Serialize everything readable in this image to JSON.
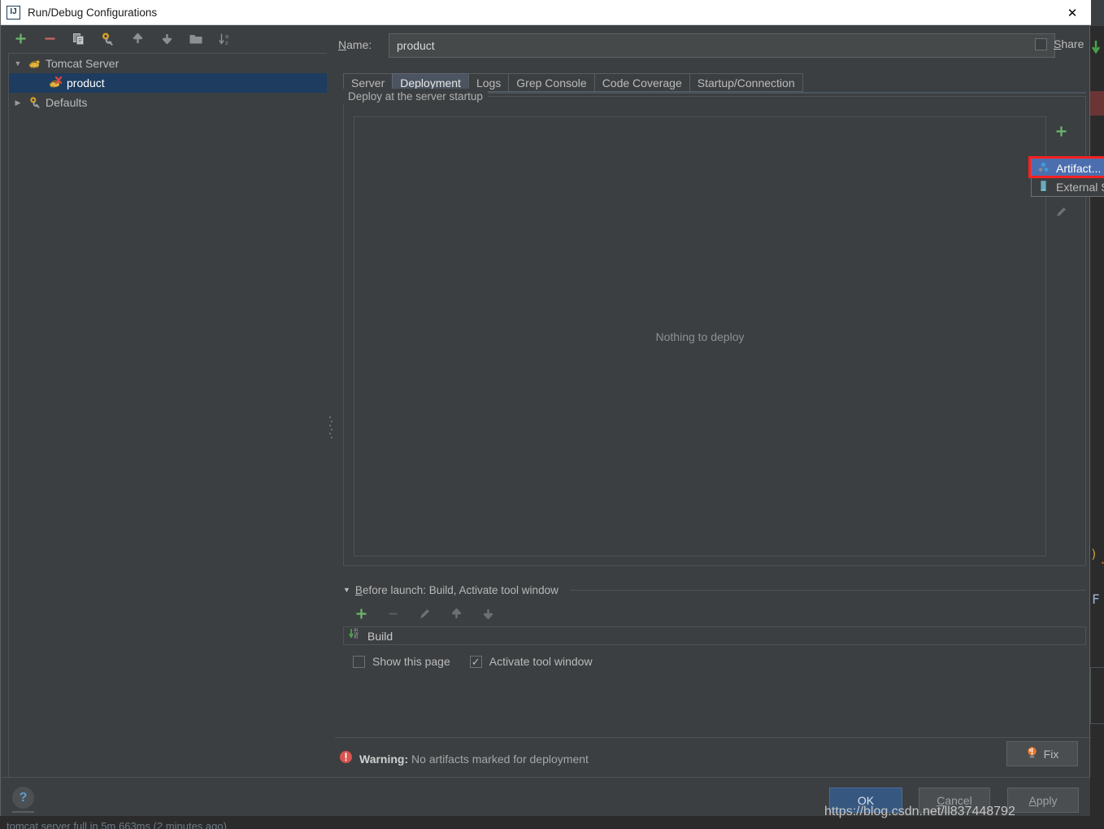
{
  "window": {
    "title": "Run/Debug Configurations",
    "logo_text": "IJ",
    "close_icon": "close-icon"
  },
  "left_toolbar": {
    "buttons": [
      {
        "name": "add-configuration-button",
        "icon": "plus-icon",
        "color": "#6cb76c"
      },
      {
        "name": "remove-configuration-button",
        "icon": "minus-icon",
        "color": "#cc6666"
      },
      {
        "name": "copy-configuration-button",
        "icon": "copy-icon",
        "color": "#9aa0a6"
      },
      {
        "name": "edit-templates-button",
        "icon": "gear-wrench-icon",
        "color": "#d9a31f"
      },
      {
        "name": "move-up-button",
        "icon": "arrow-up-icon",
        "color": "#8b9094"
      },
      {
        "name": "move-down-button",
        "icon": "arrow-down-icon",
        "color": "#8b9094"
      },
      {
        "name": "create-folder-button",
        "icon": "folder-icon",
        "color": "#8b9094"
      },
      {
        "name": "sort-configurations-button",
        "icon": "sort-az-icon",
        "color": "#8b9094"
      }
    ]
  },
  "tree": {
    "items": [
      {
        "label": "Tomcat Server",
        "icon": "tomcat-icon",
        "expanded": true,
        "arrow": "▼",
        "level": 0,
        "selected": false
      },
      {
        "label": "product",
        "icon": "tomcat-error-icon",
        "expanded": false,
        "arrow": "",
        "level": 1,
        "selected": true
      },
      {
        "label": "Defaults",
        "icon": "gear-wrench-icon",
        "expanded": false,
        "arrow": "▶",
        "level": 0,
        "selected": false
      }
    ]
  },
  "name_row": {
    "label": "Name:",
    "label_mnemonic": "N",
    "label_rest": "ame:",
    "value": "product",
    "placeholder": "Name",
    "share_label": "Share",
    "share_mnemonic": "S",
    "share_rest": "hare",
    "share_checked": false
  },
  "tabs": [
    {
      "label": "Server",
      "active": false
    },
    {
      "label": "Deployment",
      "active": true
    },
    {
      "label": "Logs",
      "active": false
    },
    {
      "label": "Grep Console",
      "active": false
    },
    {
      "label": "Code Coverage",
      "active": false
    },
    {
      "label": "Startup/Connection",
      "active": false
    }
  ],
  "deployment": {
    "group_title": "Deploy at the server startup",
    "empty_text": "Nothing to deploy",
    "side_buttons": [
      {
        "name": "add-deployment-button",
        "icon": "plus-icon",
        "enabled": true
      },
      {
        "name": "remove-deployment-button",
        "icon": "minus-icon",
        "enabled": false
      },
      {
        "name": "move-deployment-down-button",
        "icon": "arrow-down-icon",
        "enabled": false
      },
      {
        "name": "edit-deployment-button",
        "icon": "pencil-icon",
        "enabled": false
      }
    ],
    "add_popup": {
      "items": [
        {
          "label": "Artifact...",
          "icon": "artifact-icon",
          "highlighted": true
        },
        {
          "label": "External Source...",
          "icon": "external-source-icon",
          "highlighted": false
        }
      ]
    }
  },
  "before_launch": {
    "arrow": "▼",
    "title": "Before launch: Build, Activate tool window",
    "title_mnemonic": "B",
    "title_rest": "efore launch: Build, Activate tool window",
    "toolbar": [
      {
        "name": "add-task-button",
        "icon": "plus-icon",
        "enabled": true
      },
      {
        "name": "remove-task-button",
        "icon": "minus-icon",
        "enabled": false
      },
      {
        "name": "edit-task-button",
        "icon": "pencil-icon",
        "enabled": false
      },
      {
        "name": "move-task-up-button",
        "icon": "arrow-up-icon",
        "enabled": false
      },
      {
        "name": "move-task-down-button",
        "icon": "arrow-down-icon",
        "enabled": false
      }
    ],
    "task_label": "Build",
    "task_icon": "build-icon",
    "show_page_label": "Show this page",
    "show_page_checked": false,
    "activate_tool_window_label": "Activate tool window",
    "activate_tool_window_checked": true
  },
  "status": {
    "warning_prefix": "Warning:",
    "warning_message": "No artifacts marked for deployment",
    "warning_icon": "warning-icon",
    "fix_label": "Fix",
    "fix_icon": "lightbulb-icon"
  },
  "footer": {
    "help_label": "?",
    "ok_label": "OK",
    "cancel_label": "Cancel",
    "cancel_mnemonic": "C",
    "cancel_rest": "ancel",
    "apply_label": "Apply",
    "apply_mnemonic": "A",
    "apply_rest": "pply",
    "watermark": "https://blog.csdn.net/ll837448792",
    "bottom_text": "tomcat server full in 5m 663ms (2 minutes ago)"
  },
  "colors": {
    "dialog_bg": "#3c3f41",
    "editor_bg": "#2b2b2b",
    "selection_blue": "#1d3c5f",
    "accent_blue": "#4b6eaf",
    "ok_blue": "#365880",
    "highlight_red": "#ff2020",
    "green": "#6cb76c",
    "warning_red": "#d9534f"
  }
}
